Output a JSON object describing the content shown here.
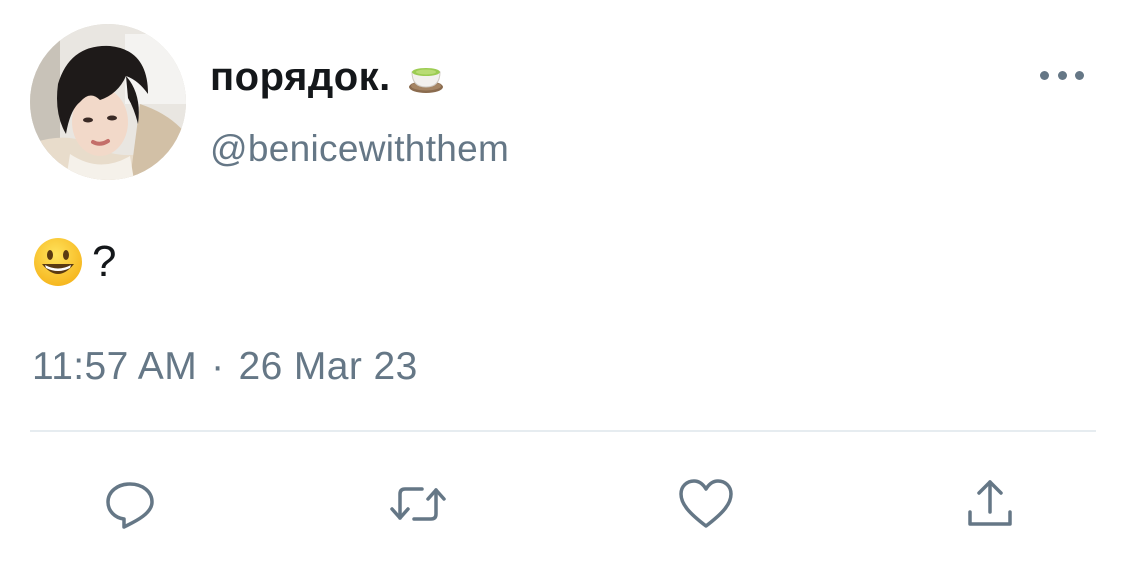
{
  "tweet": {
    "display_name": "порядок.",
    "display_name_badge": "green-tea-emoji-icon",
    "handle": "@benicewiththem",
    "body": {
      "emoji": "grinning-face-emoji-icon",
      "text": "?"
    },
    "time": "11:57 AM",
    "separator": "·",
    "date": "26 Mar 23",
    "actions": [
      "reply-icon",
      "retweet-icon",
      "like-icon",
      "share-icon"
    ]
  },
  "colors": {
    "text_primary": "#14171a",
    "text_secondary": "#657786",
    "icon": "#657786",
    "divider": "#e6ecf0",
    "background": "#ffffff"
  }
}
